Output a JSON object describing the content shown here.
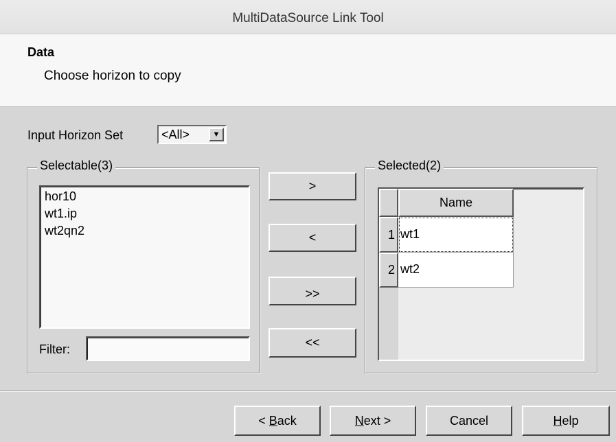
{
  "window": {
    "title": "MultiDataSource Link Tool"
  },
  "header": {
    "title": "Data",
    "subtitle": "Choose horizon to copy"
  },
  "horizon_set": {
    "label": "Input Horizon Set",
    "value": "<All>"
  },
  "selectable": {
    "title": "Selectable(3)",
    "items": [
      "hor10",
      "wt1.ip",
      "wt2qn2"
    ],
    "filter_label": "Filter:",
    "filter_value": ""
  },
  "transfer_buttons": {
    "add": ">",
    "remove": "<",
    "add_all": ">>",
    "remove_all": "<<"
  },
  "selected": {
    "title": "Selected(2)",
    "column": "Name",
    "rows": [
      {
        "index": "1",
        "name": "wt1"
      },
      {
        "index": "2",
        "name": "wt2"
      }
    ]
  },
  "footer": {
    "back": {
      "prefix": "< ",
      "mnemonic": "B",
      "rest": "ack"
    },
    "next": {
      "prefix": "",
      "mnemonic": "N",
      "rest": "ext >"
    },
    "cancel": "Cancel",
    "help": {
      "prefix": "",
      "mnemonic": "H",
      "rest": "elp"
    }
  }
}
